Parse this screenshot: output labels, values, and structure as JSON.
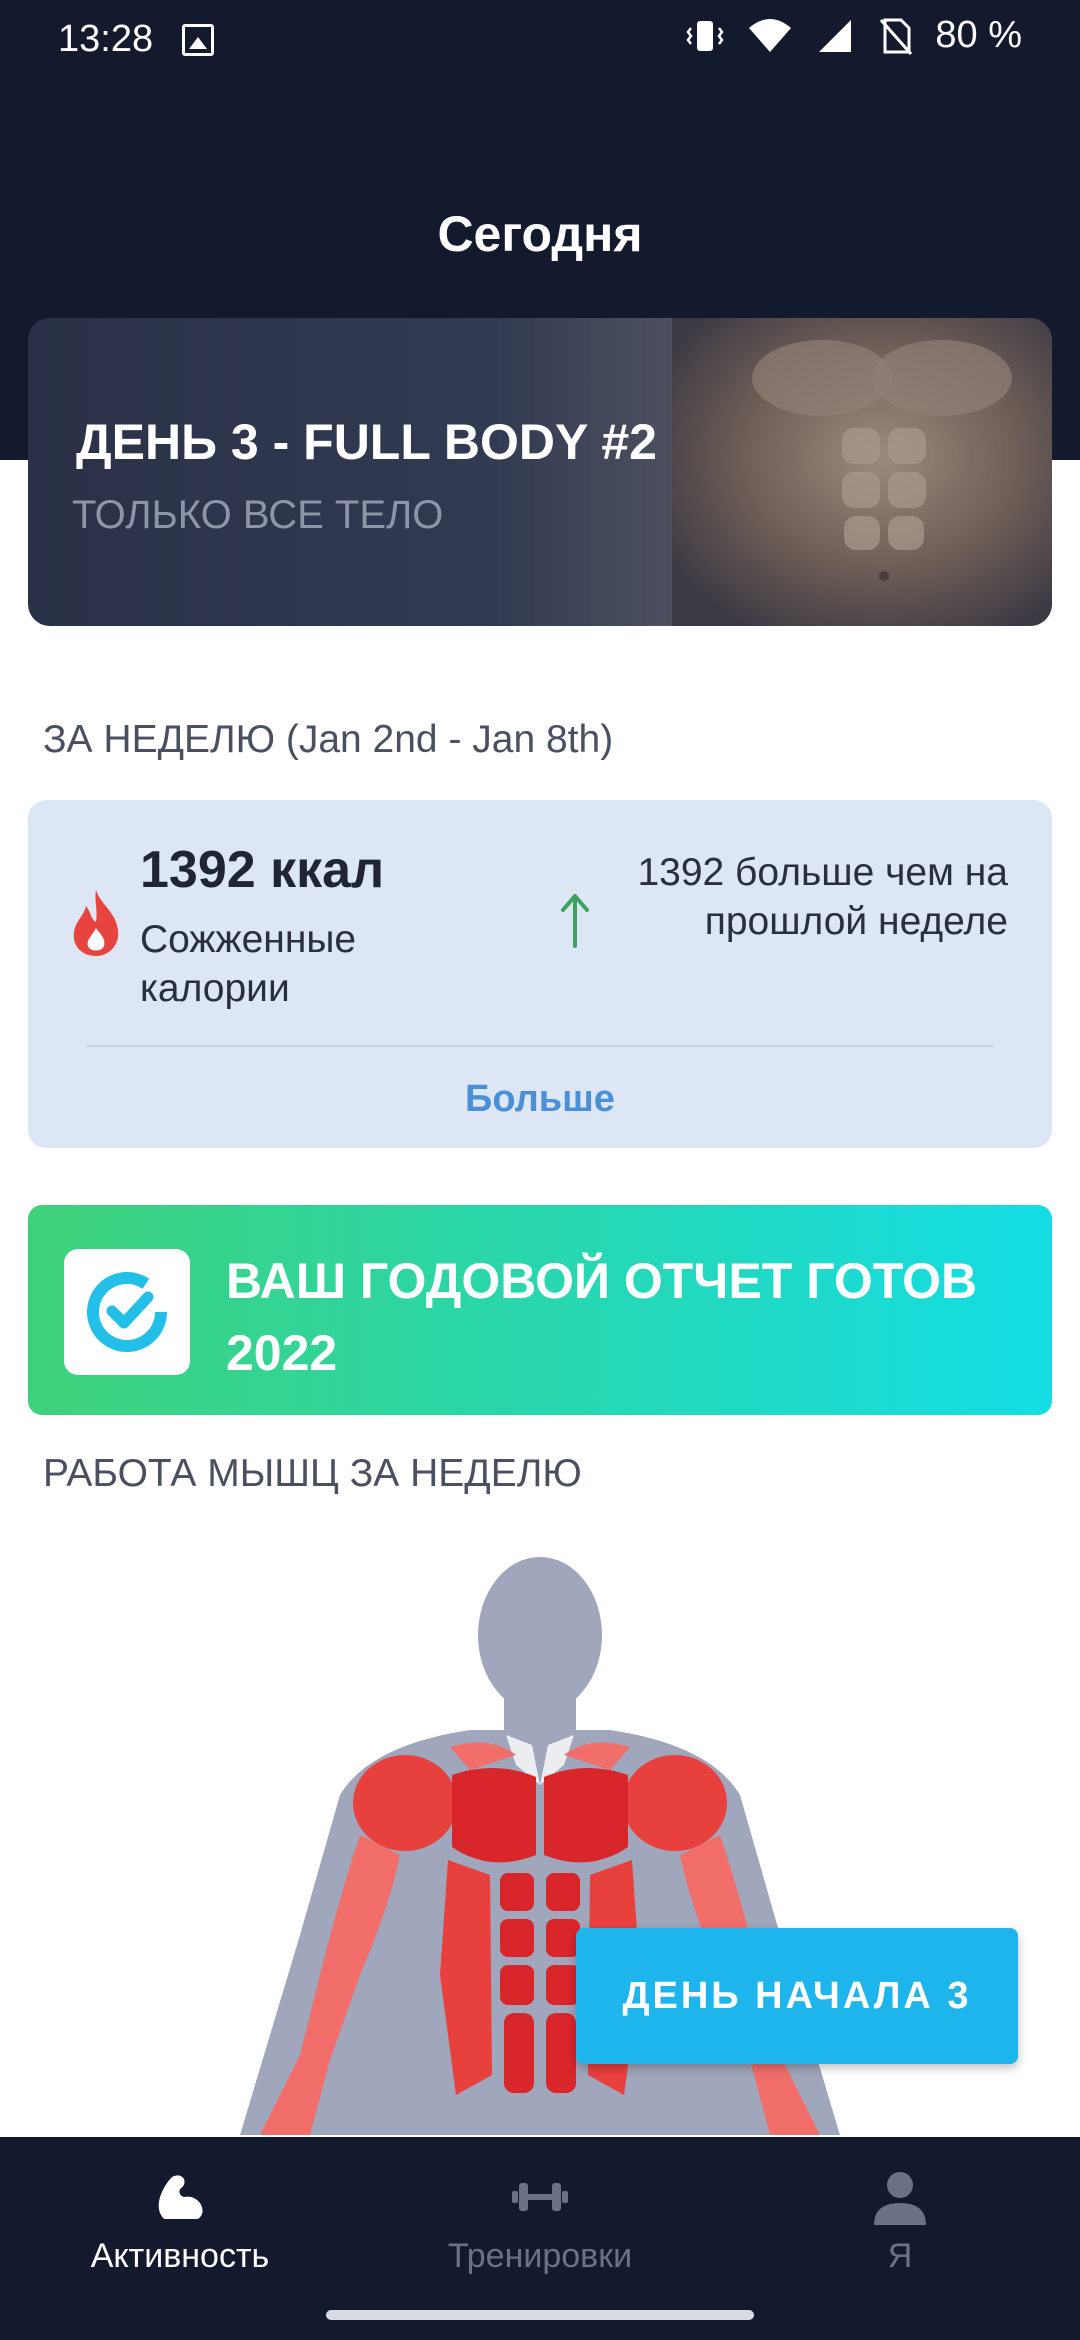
{
  "status_bar": {
    "time": "13:28",
    "battery": "80 %",
    "icons": [
      "image-icon",
      "vibrate-icon",
      "wifi-icon",
      "signal-icon",
      "no-sim-icon"
    ]
  },
  "header": {
    "title": "Сегодня"
  },
  "hero": {
    "title": "ДЕНЬ 3 - FULL BODY #2",
    "subtitle": "ТОЛЬКО ВСЕ ТЕЛО"
  },
  "week": {
    "label": "ЗА НЕДЕЛЮ (Jan 2nd - Jan 8th)",
    "kcal_value": "1392 ккал",
    "kcal_caption": "Сожженные калории",
    "compare_text": "1392 больше чем на прошлой неделе",
    "more_link": "Больше"
  },
  "report": {
    "text": "ВАШ ГОДОВОЙ ОТЧЕТ ГОТОВ 2022"
  },
  "muscles": {
    "label": "РАБОТА МЫШЦ ЗА НЕДЕЛЮ"
  },
  "start_button": {
    "label": "ДЕНЬ НАЧАЛА 3"
  },
  "bottom_nav": {
    "items": [
      {
        "label": "Активность",
        "icon": "bicep-icon",
        "active": true
      },
      {
        "label": "Тренировки",
        "icon": "dumbbell-icon",
        "active": false
      },
      {
        "label": "Я",
        "icon": "person-icon",
        "active": false
      }
    ]
  },
  "colors": {
    "header_bg": "#141a2e",
    "accent_blue": "#1eb4ec",
    "link_blue": "#4a90d9",
    "up_arrow": "#3ca35f",
    "muscle_red": "#d9262b",
    "body_grey": "#a0a6bb"
  }
}
